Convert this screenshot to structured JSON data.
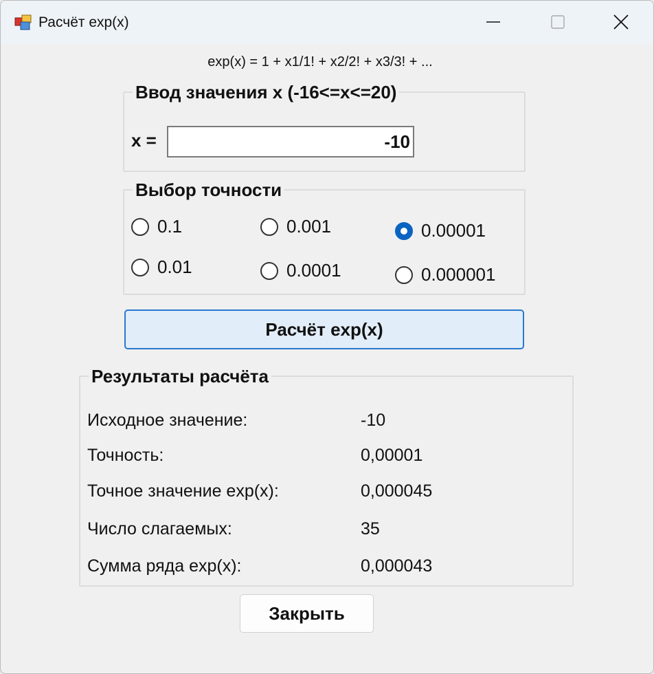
{
  "window": {
    "title": "Расчёт exp(x)"
  },
  "formula": "exp(x) = 1 + x1/1! + x2/2! + x3/3! + ...",
  "input_group": {
    "legend": "Ввод значения x (-16<=x<=20)",
    "x_label": "x =",
    "x_value": "-10"
  },
  "precision_group": {
    "legend": "Выбор точности",
    "options": [
      {
        "label": "0.1",
        "checked": false
      },
      {
        "label": "0.01",
        "checked": false
      },
      {
        "label": "0.001",
        "checked": false
      },
      {
        "label": "0.0001",
        "checked": false
      },
      {
        "label": "0.00001",
        "checked": true
      },
      {
        "label": "0.000001",
        "checked": false
      }
    ]
  },
  "calc_button_label": "Расчёт exp(x)",
  "results_group": {
    "legend": "Результаты расчёта",
    "rows": [
      {
        "label": "Исходное значение:",
        "value": "-10"
      },
      {
        "label": "Точность:",
        "value": "0,00001"
      },
      {
        "label": "Точное значение exp(x):",
        "value": "0,000045"
      },
      {
        "label": "Число слагаемых:",
        "value": "35"
      },
      {
        "label": "Сумма ряда exp(x):",
        "value": "0,000043"
      }
    ]
  },
  "close_button_label": "Закрыть",
  "colors": {
    "accent": "#0a64c2",
    "button_bg": "#e1edf8",
    "window_bg": "#f0f0f0"
  }
}
